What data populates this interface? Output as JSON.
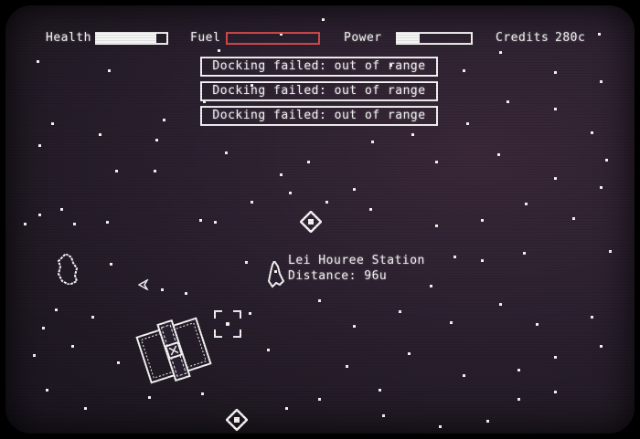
{
  "hud": {
    "health": {
      "label": "Health",
      "level": 0.85
    },
    "fuel": {
      "label": "Fuel",
      "level": 0.0,
      "color": "#d24a4a"
    },
    "power": {
      "label": "Power",
      "level": 0.3
    },
    "credits": {
      "label": "Credits",
      "value": "280c"
    }
  },
  "messages": [
    "Docking failed: out of range",
    "Docking failed: out of range",
    "Docking failed: out of range"
  ],
  "target": {
    "name": "Lei Houree Station",
    "distance": "Distance: 96u"
  },
  "colors": {
    "foreground": "#f4f4f4",
    "background": "#2a2030"
  },
  "icons": [
    "player-ship-icon",
    "station-icon",
    "target-reticle-icon",
    "asteroid-icon",
    "drone-icon"
  ]
}
